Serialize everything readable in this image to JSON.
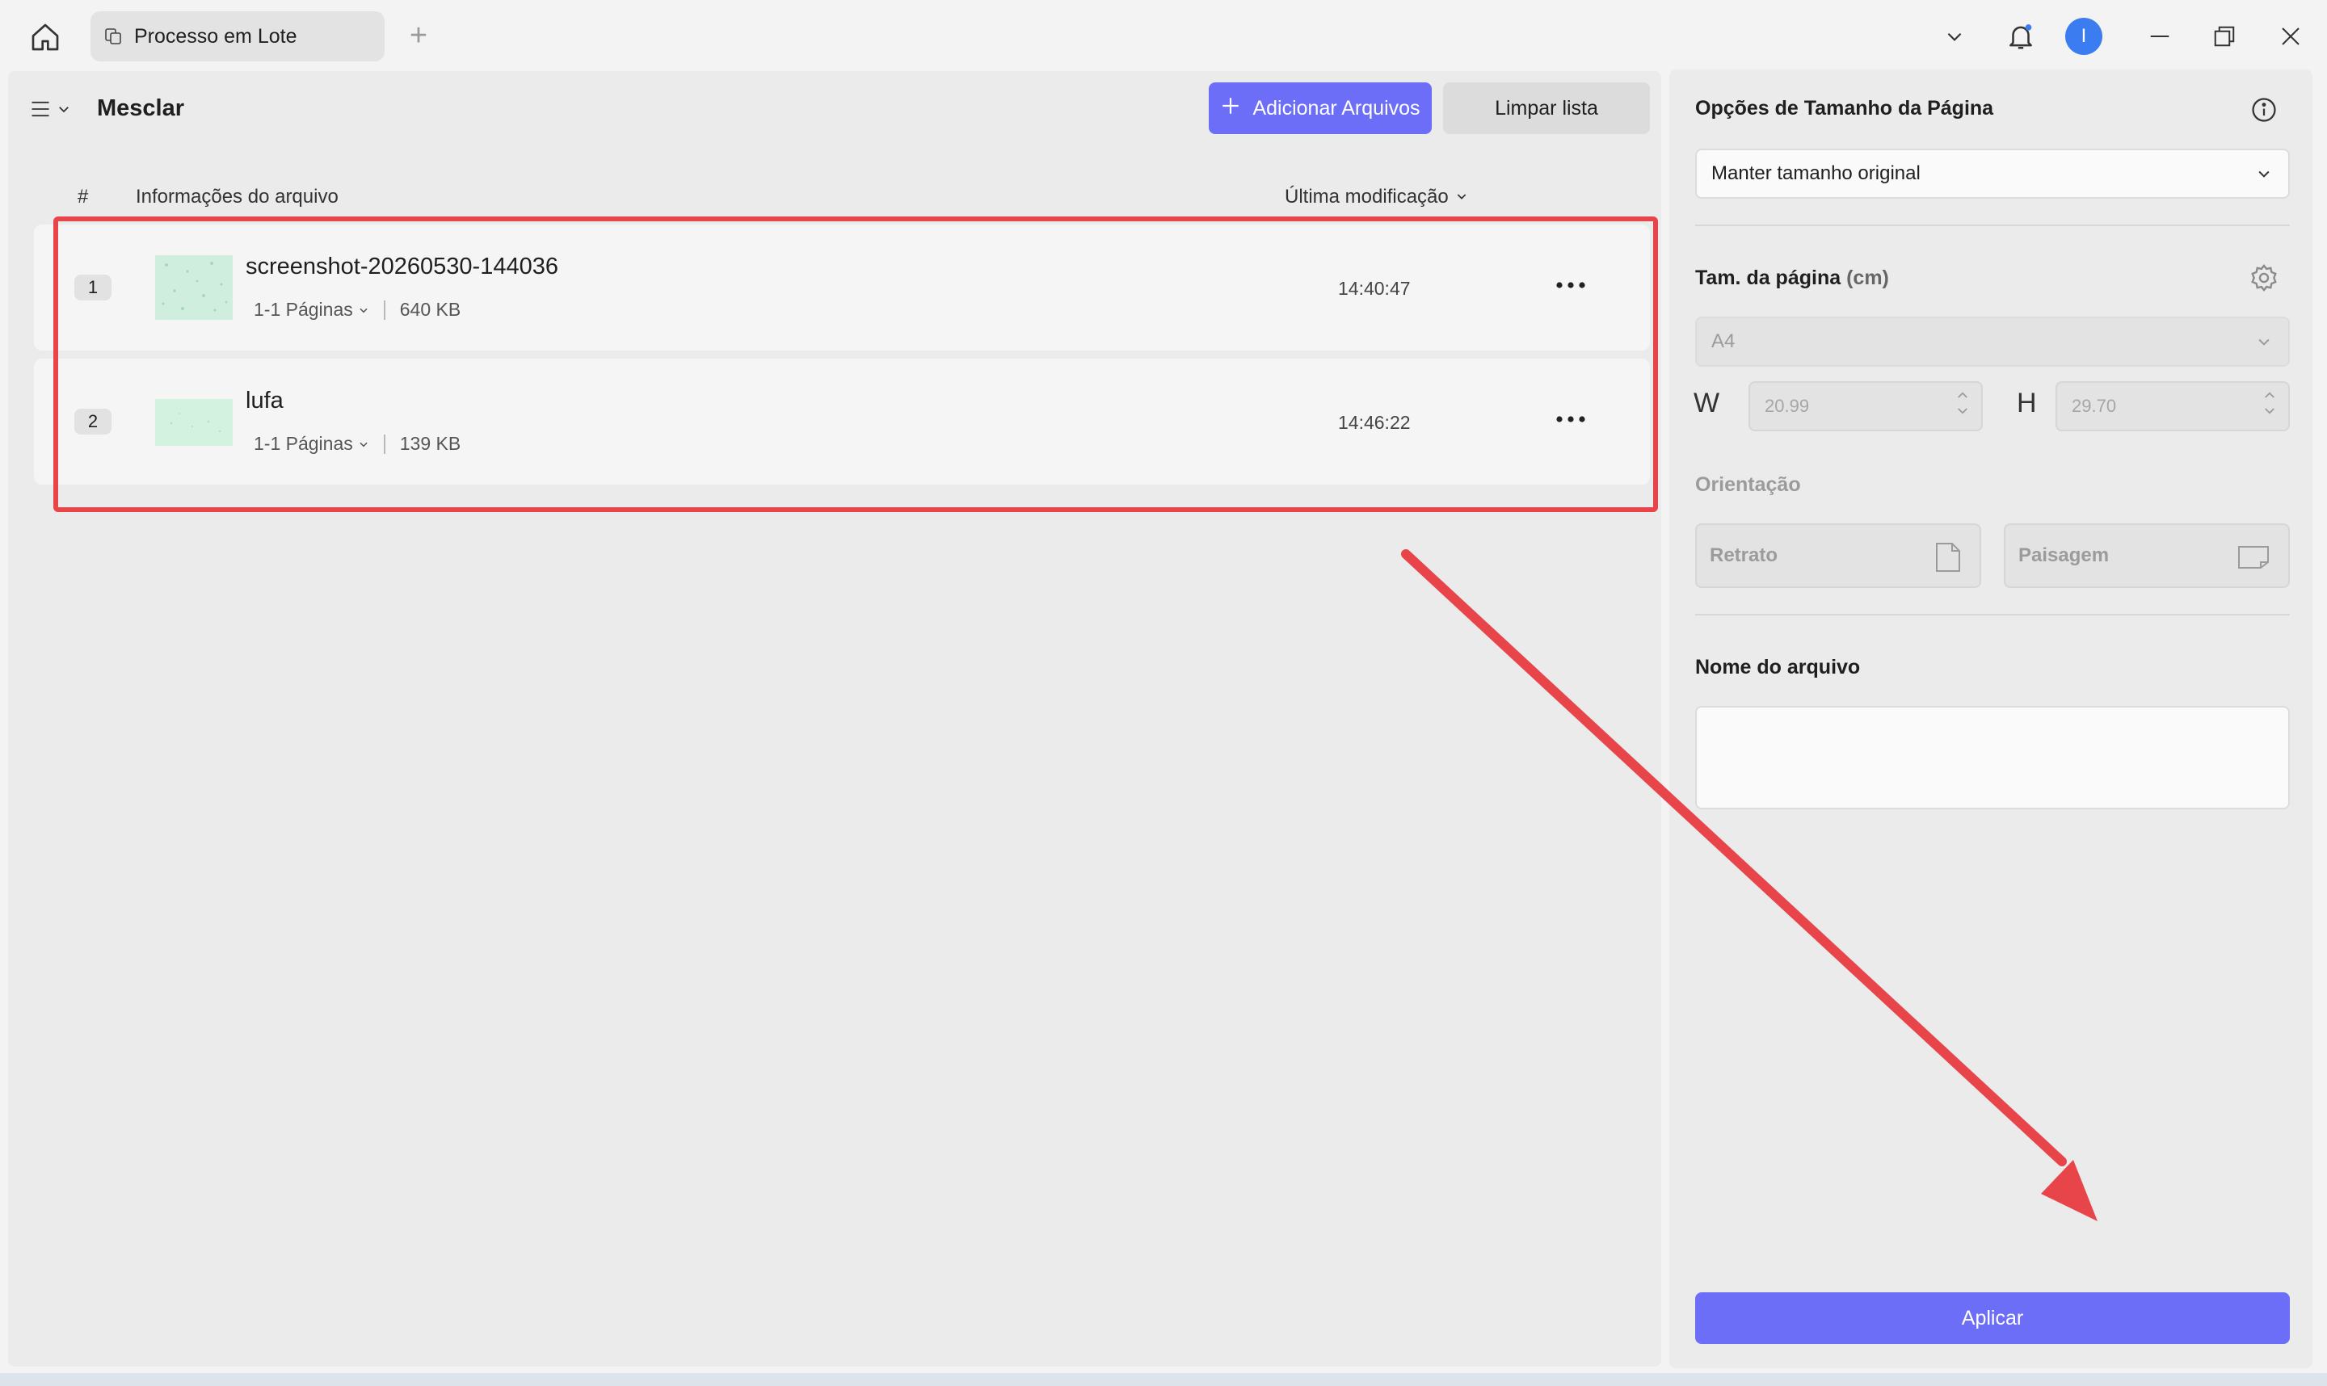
{
  "window": {
    "tab_title": "Processo em Lote",
    "avatar_initial": "I",
    "icons": {
      "home": "home-icon",
      "tab": "documents-icon",
      "new_tab": "plus-icon",
      "dropdown": "chevron-down-icon",
      "notifications": "bell-icon",
      "minimize": "minimize-icon",
      "restore": "restore-icon",
      "close": "close-icon"
    }
  },
  "left_panel": {
    "menu_icon": "menu-icon",
    "title": "Mesclar",
    "add_files_label": "Adicionar Arquivos",
    "clear_list_label": "Limpar lista",
    "columns": {
      "number": "#",
      "info": "Informações do arquivo",
      "modified": "Última modificação"
    },
    "files": [
      {
        "index": "1",
        "name": "screenshot-20260530-144036",
        "pages": "1-1 Páginas",
        "size": "640 KB",
        "modified": "14:40:47"
      },
      {
        "index": "2",
        "name": "lufa",
        "pages": "1-1 Páginas",
        "size": "139 KB",
        "modified": "14:46:22"
      }
    ]
  },
  "right_panel": {
    "page_size_options_label": "Opções de Tamanho da Página",
    "page_size_option_value": "Manter tamanho original",
    "page_size_label": "Tam. da página",
    "page_size_unit": "(cm)",
    "paper_format": "A4",
    "width_letter": "W",
    "width_value": "20.99",
    "height_letter": "H",
    "height_value": "29.70",
    "orientation_label": "Orientação",
    "portrait_label": "Retrato",
    "landscape_label": "Paisagem",
    "filename_label": "Nome do arquivo",
    "filename_value": "",
    "apply_label": "Aplicar"
  },
  "colors": {
    "accent": "#6c6ef7",
    "highlight": "#e8454b",
    "avatar": "#3b7df0"
  }
}
